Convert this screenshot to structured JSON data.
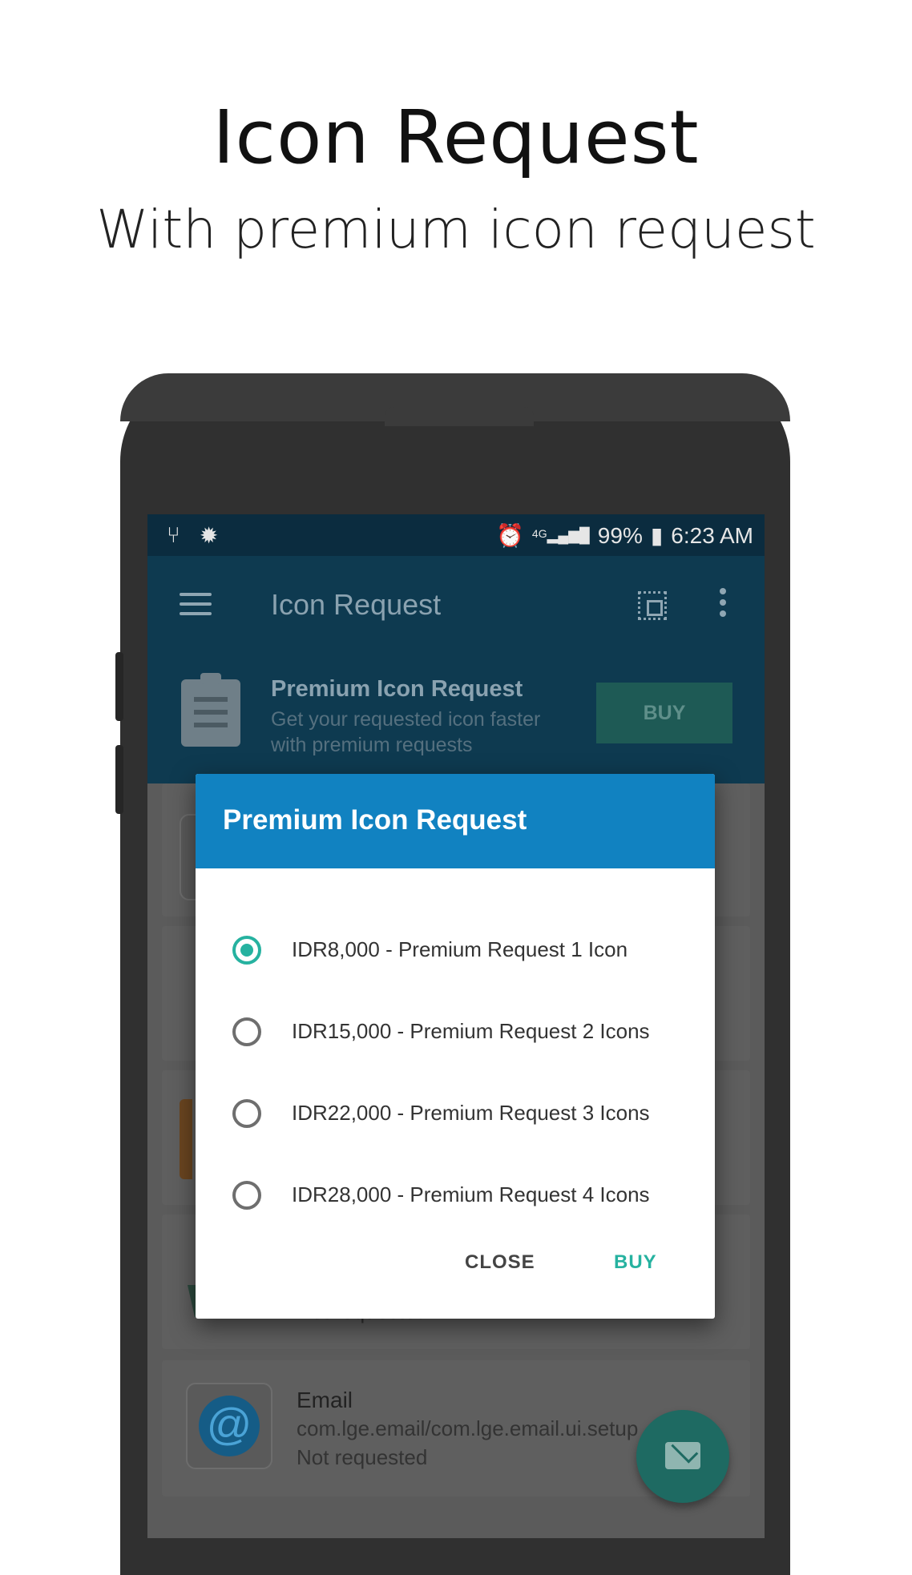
{
  "promo": {
    "title": "Icon Request",
    "subtitle": "With premium icon request"
  },
  "status_bar": {
    "battery": "99%",
    "time": "6:23 AM",
    "network": "4G",
    "icons": [
      "usb-icon",
      "bug-icon",
      "alarm-icon",
      "signal-icon",
      "battery-charging-icon"
    ]
  },
  "app_bar": {
    "title": "Icon Request"
  },
  "premium_banner": {
    "title": "Premium Icon Request",
    "description": "Get your requested icon faster with premium requests",
    "buy_label": "BUY"
  },
  "list": {
    "status_text": "Not requested",
    "email_item": {
      "name": "Email",
      "package": "com.lge.email/com.lge.email.ui.setup",
      "status": "Not requested"
    }
  },
  "dialog": {
    "title": "Premium Icon Request",
    "options": [
      {
        "label": "IDR8,000 - Premium Request 1 Icon",
        "selected": true
      },
      {
        "label": "IDR15,000 - Premium Request 2 Icons",
        "selected": false
      },
      {
        "label": "IDR22,000 - Premium Request 3 Icons",
        "selected": false
      },
      {
        "label": "IDR28,000 - Premium Request 4 Icons",
        "selected": false
      }
    ],
    "close_label": "CLOSE",
    "buy_label": "BUY"
  },
  "colors": {
    "accent": "#26b2a0",
    "dialog_header": "#1182c1",
    "app_bar": "#0e3a50"
  }
}
